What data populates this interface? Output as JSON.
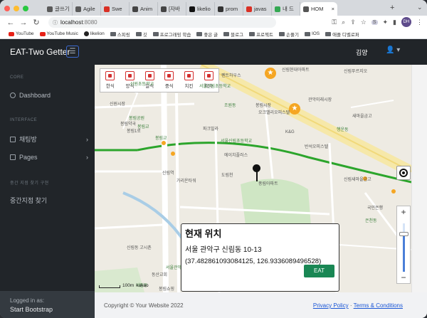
{
  "browser": {
    "tabs": [
      {
        "label": "글쓰기",
        "favicon_color": "#5a5a5a",
        "active": false
      },
      {
        "label": "Agile",
        "favicon_color": "#5a5a5a",
        "active": false
      },
      {
        "label": "Swe",
        "favicon_color": "#d93025",
        "active": false
      },
      {
        "label": "Anim",
        "favicon_color": "#444444",
        "active": false
      },
      {
        "label": "[자바",
        "favicon_color": "#444444",
        "active": false
      },
      {
        "label": "likelio",
        "favicon_color": "#111111",
        "active": false
      },
      {
        "label": "prom",
        "favicon_color": "#333333",
        "active": false
      },
      {
        "label": "javas",
        "favicon_color": "#d93025",
        "active": false
      },
      {
        "label": "내 드",
        "favicon_color": "#34a853",
        "active": false
      },
      {
        "label": "HOM",
        "favicon_color": "#555555",
        "active": true
      }
    ],
    "url_host": "localhost",
    "url_port": ":8080",
    "profile_initials": "DH",
    "bookmarks": [
      "YouTube",
      "YouTube Music",
      "likelion",
      "스피링",
      "깃",
      "프로그래밍 학습",
      "좋은 글",
      "블로그",
      "프로젝트",
      "손풀기",
      "IOS",
      "애플 디벨로퍼"
    ]
  },
  "app": {
    "brand": "EAT-Two Getter",
    "username": "김양",
    "sidebar": {
      "core_heading": "CORE",
      "dashboard": "Dashboard",
      "interface_heading": "INTERFACE",
      "chat": "채팅방",
      "pages": "Pages",
      "midpoint_heading": "중간 지점 찾기 구현",
      "midpoint_item": "중간지점 찾기",
      "footer_label": "Logged in as:",
      "footer_value": "Start Bootstrap"
    },
    "categories": [
      "한식",
      "양식",
      "일식",
      "중식",
      "치킨",
      "피자"
    ],
    "map": {
      "labels": [
        "신림현대아파트",
        "신림푸르지오",
        "펜트하우스",
        "신원시장",
        "상원초등학교",
        "봉림공원",
        "봉림약국",
        "봉림교",
        "서울신림초등학교",
        "봉림1로",
        "봉림교",
        "조원동",
        "봉림시장",
        "파크빌라",
        "오크밸리오피스텔",
        "관악미래시장",
        "K&G",
        "행운동",
        "새마을금고",
        "반석오피스텔",
        "서울신림초등학교",
        "에이치플러스",
        "도림천",
        "가리온타워",
        "신림역",
        "신림새마을금고",
        "국민은행",
        "은천동",
        "풍림아파트",
        "신림동 고시촌",
        "서원동",
        "서울관악동",
        "동산교회",
        "봉림쇼핑",
        "관악구청"
      ],
      "scale_label": "100m",
      "provider": "kakao"
    },
    "popup": {
      "title": "현재 위치",
      "address": "서울 관악구 신림동 10-13",
      "coords": "(37.482861093084125, 126.9336089496528)",
      "button": "EAT"
    },
    "footer": {
      "copyright": "Copyright © Your Website 2022",
      "privacy": "Privacy Policy",
      "separator": " · ",
      "terms": "Terms & Conditions"
    }
  }
}
